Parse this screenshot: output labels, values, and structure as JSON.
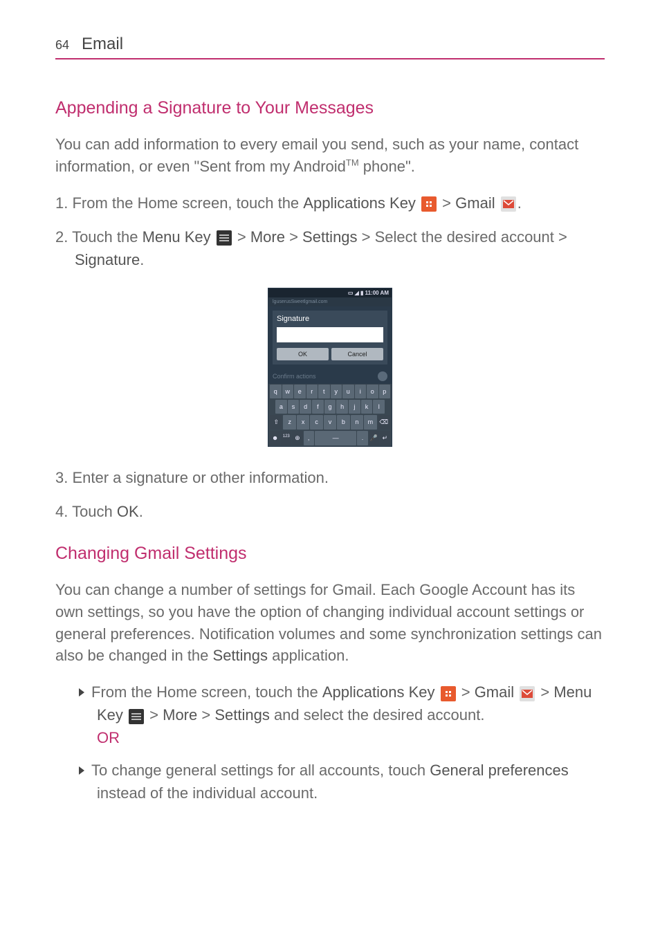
{
  "page": {
    "number": "64",
    "section": "Email"
  },
  "section1": {
    "heading": "Appending a Signature to Your Messages",
    "intro_a": "You can add information to every email you send, such as your name, contact information, or even \"Sent from my Android",
    "intro_tm": "TM",
    "intro_b": " phone\".",
    "step1_a": "1.  From the Home screen, touch the ",
    "step1_b": "Applications Key",
    "step1_c": " > ",
    "step1_d": "Gmail",
    "step1_e": ".",
    "step2_a": "2. Touch the ",
    "step2_b": "Menu Key",
    "step2_c": " > ",
    "step2_d": "More",
    "step2_e": " > ",
    "step2_f": "Settings",
    "step2_g": " > Select the desired account > ",
    "step2_h": "Signature",
    "step2_i": ".",
    "step3": "3. Enter a signature or other information.",
    "step4_a": "4. Touch ",
    "step4_b": "OK",
    "step4_c": "."
  },
  "phone": {
    "time": "11:00 AM",
    "address": "lguserusSweetlgmail.com",
    "dialog_title": "Signature",
    "ok": "OK",
    "cancel": "Cancel",
    "confirm": "Confirm actions",
    "kbd_row1": [
      "q",
      "w",
      "e",
      "r",
      "t",
      "y",
      "u",
      "i",
      "o",
      "p"
    ],
    "kbd_row2": [
      "a",
      "s",
      "d",
      "f",
      "g",
      "h",
      "j",
      "k",
      "l"
    ],
    "kbd_row3": [
      "⇧",
      "z",
      "x",
      "c",
      "v",
      "b",
      "n",
      "m",
      "⌫"
    ]
  },
  "section2": {
    "heading": "Changing Gmail Settings",
    "intro_a": "You can change a number of settings for Gmail. Each Google Account has its own settings, so you have the option of changing individual account settings or general preferences. Notification volumes and some synchronization settings can also be changed in the ",
    "intro_b": "Settings",
    "intro_c": " application.",
    "b1_a": "From the Home screen, touch the ",
    "b1_b": "Applications Key",
    "b1_c": " > ",
    "b1_d": "Gmail",
    "b1_e": " > ",
    "b1_f": "Menu Key",
    "b1_g": " > ",
    "b1_h": "More",
    "b1_i": " > ",
    "b1_j": "Settings",
    "b1_k": " and select the desired account.",
    "or": "OR",
    "b2_a": "To change general settings for all accounts, touch ",
    "b2_b": "General preferences",
    "b2_c": " instead of the individual account."
  }
}
